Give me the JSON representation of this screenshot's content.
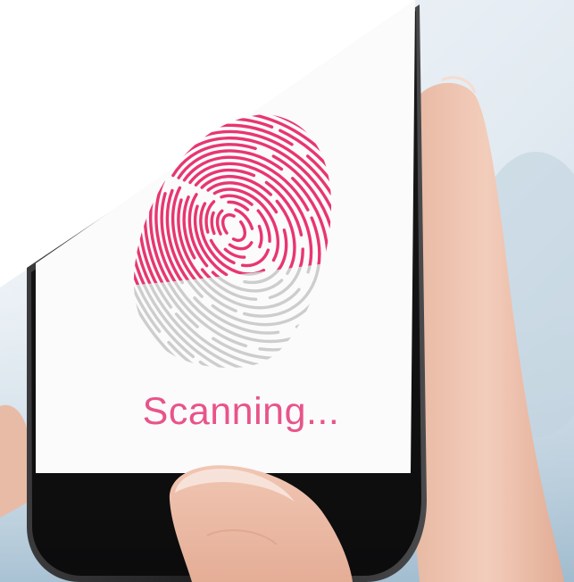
{
  "screen": {
    "status_text": "Scanning...",
    "status_color": "#e8548a"
  },
  "fingerprint": {
    "scanned_color": "#e8366f",
    "unscanned_color": "#cdcdcd",
    "scan_progress": 0.62
  },
  "icons": {
    "fingerprint": "fingerprint-icon",
    "home_button": "home-button"
  }
}
